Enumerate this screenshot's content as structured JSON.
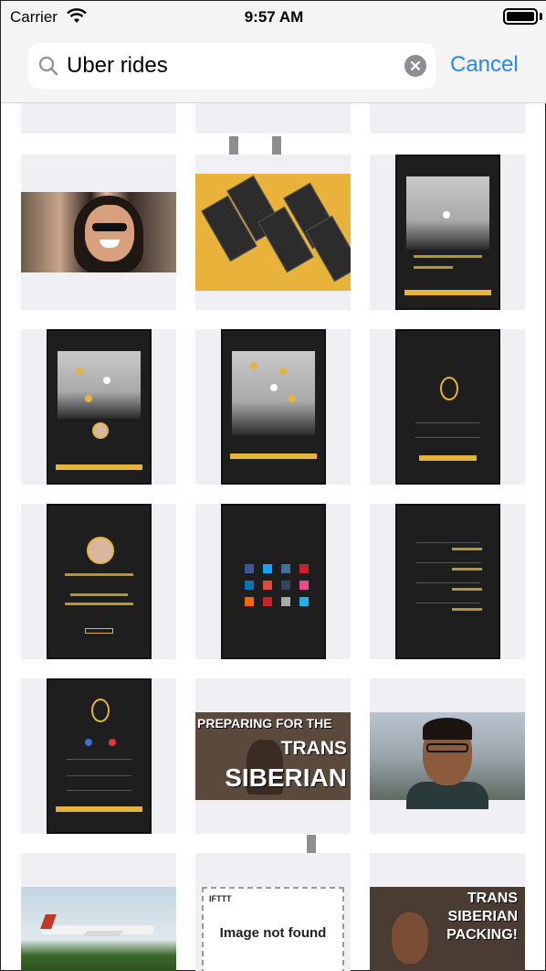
{
  "status_bar": {
    "carrier": "Carrier",
    "time": "9:57 AM"
  },
  "search": {
    "query": "Uber rides",
    "placeholder": "",
    "cancel_label": "Cancel"
  },
  "results": [
    {
      "kind": "photo-woman-sunglasses"
    },
    {
      "kind": "app-mockup-yellow"
    },
    {
      "kind": "taxi-app-map-screen"
    },
    {
      "kind": "taxi-app-driver-map"
    },
    {
      "kind": "taxi-app-route-map"
    },
    {
      "kind": "taxi-app-login"
    },
    {
      "kind": "taxi-app-profile"
    },
    {
      "kind": "taxi-app-share-social"
    },
    {
      "kind": "taxi-app-history-list"
    },
    {
      "kind": "taxi-app-signup"
    },
    {
      "kind": "video-thumbnail-trans-siberian"
    },
    {
      "kind": "photo-man-glasses"
    },
    {
      "kind": "photo-airplane"
    },
    {
      "kind": "image-not-found"
    },
    {
      "kind": "video-thumbnail-packing"
    }
  ],
  "thumb_text": {
    "trans_line1": "PREPARING FOR THE",
    "trans_line2": "TRANS",
    "trans_line3": "SIBERIAN",
    "ifttt": "IFTTT",
    "not_found": "Image not found",
    "packing_line1": "TRANS",
    "packing_line2": "SIBERIAN",
    "packing_line3": "PACKING!"
  },
  "colors": {
    "accent": "#2a86f0",
    "taxi_yellow": "#e6b33c",
    "tile_bg": "#efeff4"
  }
}
